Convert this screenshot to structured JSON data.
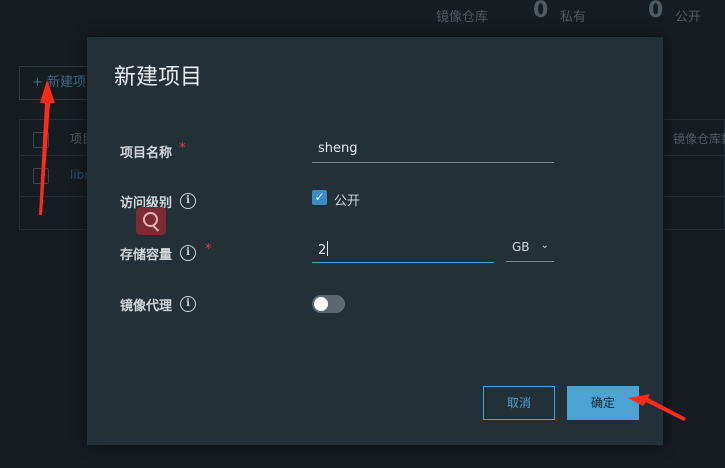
{
  "header_stats": {
    "registry_label": "镜像仓库",
    "private_count": "0",
    "private_label": "私有",
    "public_count": "0",
    "public_label": "公开"
  },
  "background": {
    "new_project_button": "+ 新建项",
    "table_header_name": "项目",
    "table_header_right": "镜像仓库数",
    "table_row_name": "libra"
  },
  "modal": {
    "title": "新建项目",
    "fields": {
      "project_name": {
        "label": "项目名称",
        "required": "*",
        "value": "sheng"
      },
      "access_level": {
        "label": "访问级别",
        "info": "i",
        "checkbox_checked": true,
        "checkbox_label": "公开"
      },
      "storage_quota": {
        "label": "存储容量",
        "info": "i",
        "required": "*",
        "value": "2",
        "unit": "GB"
      },
      "image_proxy": {
        "label": "镜像代理",
        "info": "i",
        "toggle_on": false
      }
    },
    "cancel_label": "取消",
    "confirm_label": "确定"
  },
  "colors": {
    "accent": "#4aa3d1",
    "modal_bg": "#233038",
    "page_bg": "#151c22",
    "required": "#e23b3b",
    "annotation_arrow": "#ff2a1a"
  },
  "icons": {
    "info": "info-circle-icon",
    "check": "checkmark-icon",
    "chevron": "chevron-down-icon",
    "search": "search-icon"
  }
}
